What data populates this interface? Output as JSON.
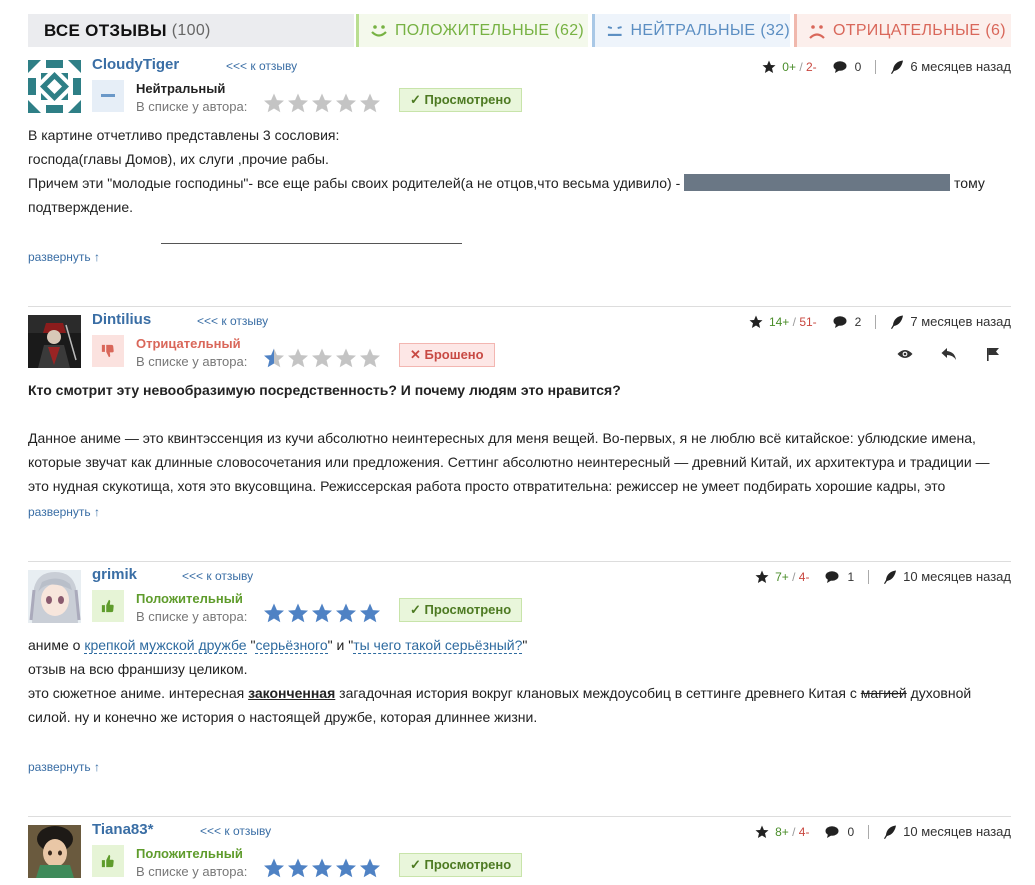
{
  "tabs": {
    "all": {
      "label": "ВСЕ ОТЗЫВЫ",
      "count": "(100)"
    },
    "positive": {
      "label": "ПОЛОЖИТЕЛЬНЫЕ",
      "count": "(62)"
    },
    "neutral": {
      "label": "НЕЙТРАЛЬНЫЕ",
      "count": "(32)"
    },
    "negative": {
      "label": "ОТРИЦАТЕЛЬНЫЕ",
      "count": "(6)"
    }
  },
  "common": {
    "to_review": "<<< к отзыву",
    "in_list": "В списке у автора:",
    "expand": "развернуть ↑"
  },
  "reviews": [
    {
      "author": "CloudyTiger",
      "verdict": "Нейтральный",
      "rating": 0,
      "status": "✓  Просмотрено",
      "plus": "0+",
      "minus": "2-",
      "comments": "0",
      "date": "6 месяцев назад",
      "lines": [
        "В картине отчетливо представлены 3 сословия:",
        "господа(главы Домов), их слуги ,прочие рабы.",
        "Причем эти \"молодые господины\"- все еще рабы своих родителей(а не отцов,что весьма удивило) - ",
        "тому",
        "подтверждение."
      ]
    },
    {
      "author": "Dintilius",
      "verdict": "Отрицательный",
      "rating": 0.5,
      "status": "✕  Брошено",
      "plus": "14+",
      "minus": "51-",
      "comments": "2",
      "date": "7 месяцев назад",
      "lines": [
        "Кто смотрит эту невообразимую посредственность? И почему людям это нравится?",
        "Данное аниме — это квинтэссенция из кучи абсолютно неинтересных для меня вещей. Во-первых, я не люблю всё китайское: ублюдские имена,",
        "которые звучат как длинные словосочетания или предложения. Сеттинг абсолютно неинтересный — древний Китай, их архитектура и традиции —",
        "это нудная скукотища, хотя это вкусовщина. Режиссерская работа просто отвратительна: режиссер не умеет подбирать хорошие кадры, это"
      ]
    },
    {
      "author": "grimik",
      "verdict": "Положительный",
      "rating": 5,
      "status": "✓  Просмотрено",
      "plus": "7+",
      "minus": "4-",
      "comments": "1",
      "date": "10 месяцев назад",
      "l1a": "аниме о ",
      "l1link1": "крепкой мужской дружбе",
      "l1b": " \"",
      "l1link2": "серьёзного",
      "l1c": "\" и \"",
      "l1link3": "ты чего такой серьёзный?",
      "l1d": "\"",
      "l2": "отзыв на всю франшизу целиком.",
      "l3a": "это сюжетное аниме. интересная ",
      "l3u": "законченная",
      "l3b": " загадочная история вокруг клановых междоусобиц в сеттинге древнего Китая с ",
      "l3s": "магией",
      "l3c": " духовной",
      "l4": "силой. ну и конечно же история о настоящей дружбе, которая длиннее жизни."
    },
    {
      "author": "Tiana83*",
      "verdict": "Положительный",
      "rating": 5,
      "status": "✓  Просмотрено",
      "plus": "8+",
      "minus": "4-",
      "comments": "0",
      "date": "10 месяцев назад"
    }
  ],
  "colors": {
    "link": "#3a6ea5",
    "positive": "#77b243",
    "neutral": "#5b8ec2",
    "negative": "#d9675a",
    "star_on": "#4f82c4",
    "star_off": "#c4c4c4"
  }
}
